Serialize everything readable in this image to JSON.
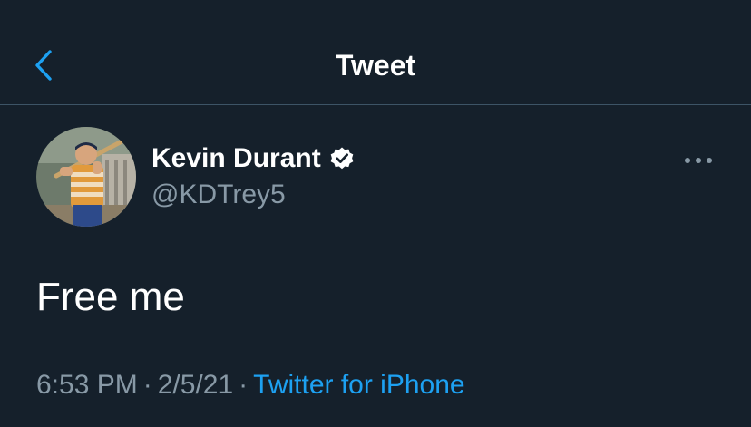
{
  "header": {
    "title": "Tweet",
    "back_icon": "chevron-left-icon",
    "accent_color": "#1da1f2"
  },
  "author": {
    "display_name": "Kevin Durant",
    "handle": "@KDTrey5",
    "verified": true,
    "verified_icon": "verified-badge-icon"
  },
  "more_icon": "ellipsis-icon",
  "tweet": {
    "text": "Free me",
    "time": "6:53 PM",
    "date": "2/5/21",
    "separator": "·",
    "source": "Twitter for iPhone"
  },
  "colors": {
    "background": "#15202b",
    "divider": "#3d5466",
    "secondary_text": "#8899a6",
    "link": "#1da1f2"
  }
}
